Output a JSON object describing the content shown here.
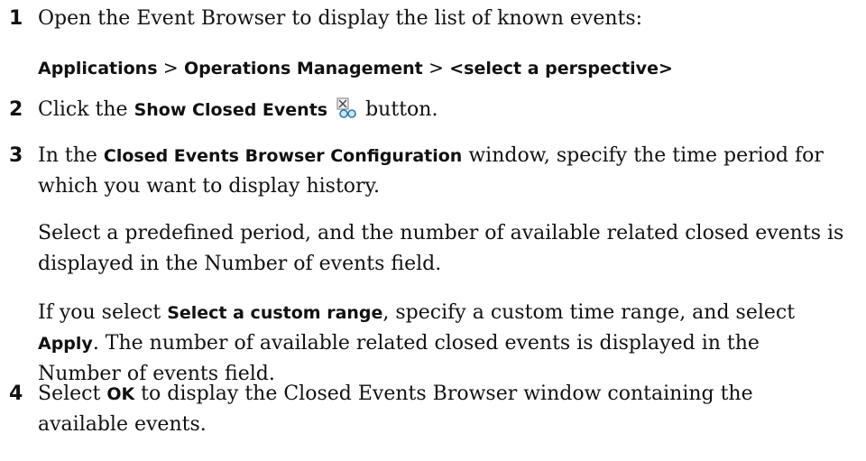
{
  "steps": [
    {
      "number": "1",
      "line1": "Open the Event Browser to display the list of known events:",
      "path": {
        "p1": "Applications",
        "sep1": " > ",
        "p2": "Operations Management",
        "sep2": " > ",
        "p3": "<select a perspective>"
      }
    },
    {
      "number": "2",
      "pre": "Click the ",
      "bold": "Show Closed Events",
      "post": " button.",
      "icon": "show-closed-events-icon"
    },
    {
      "number": "3",
      "pre": "In the ",
      "bold": "Closed Events Browser Configuration",
      "post": " window, specify the time period for which you want to display history.",
      "para2": "Select a predefined period, and the number of available related closed events is displayed in the Number of events field.",
      "para3_pre": "If you select ",
      "para3_bold1": "Select a custom range",
      "para3_mid": ", specify a custom time range, and select ",
      "para3_bold2": "Apply",
      "para3_post": ". The number of available related closed events is displayed in the Number of events field."
    },
    {
      "number": "4",
      "pre": "Select ",
      "bold": "OK",
      "post": " to display the Closed Events Browser window containing the available events."
    }
  ]
}
